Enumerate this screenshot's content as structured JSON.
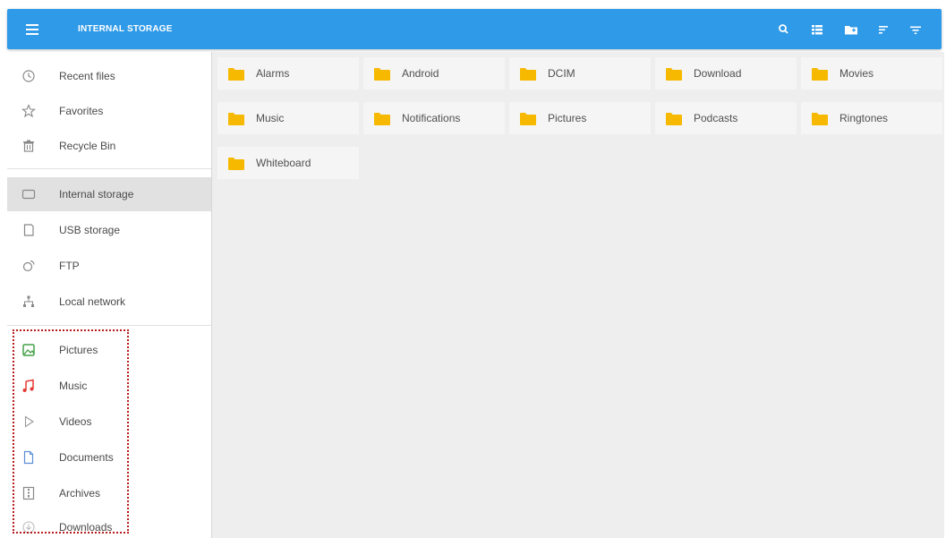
{
  "topbar": {
    "title": "INTERNAL STORAGE",
    "color": "#2f9ae8",
    "icons": [
      "menu-icon",
      "search-icon",
      "view-list-icon",
      "new-folder-icon",
      "sort-icon",
      "filter-icon"
    ]
  },
  "sidebar": {
    "items": [
      {
        "label": "Recent files",
        "icon": "clock-icon"
      },
      {
        "label": "Favorites",
        "icon": "star-icon"
      },
      {
        "label": "Recycle Bin",
        "icon": "trash-icon"
      },
      {
        "label": "Internal storage",
        "icon": "storage-icon",
        "active": true
      },
      {
        "label": "USB storage",
        "icon": "usb-icon"
      },
      {
        "label": "FTP",
        "icon": "ftp-icon"
      },
      {
        "label": "Local network",
        "icon": "network-icon"
      },
      {
        "label": "Pictures",
        "icon": "pictures-icon"
      },
      {
        "label": "Music",
        "icon": "music-icon"
      },
      {
        "label": "Videos",
        "icon": "video-icon"
      },
      {
        "label": "Documents",
        "icon": "document-icon"
      },
      {
        "label": "Archives",
        "icon": "archive-icon"
      },
      {
        "label": "Downloads",
        "icon": "download-icon"
      }
    ]
  },
  "folders": [
    "Alarms",
    "Android",
    "DCIM",
    "Download",
    "Movies",
    "Music",
    "Notifications",
    "Pictures",
    "Podcasts",
    "Ringtones",
    "Whiteboard"
  ],
  "colors": {
    "folder": "#f6b900",
    "music_accent": "#e53935",
    "pictures_accent": "#43a047",
    "highlight_border": "#b71c1c"
  }
}
